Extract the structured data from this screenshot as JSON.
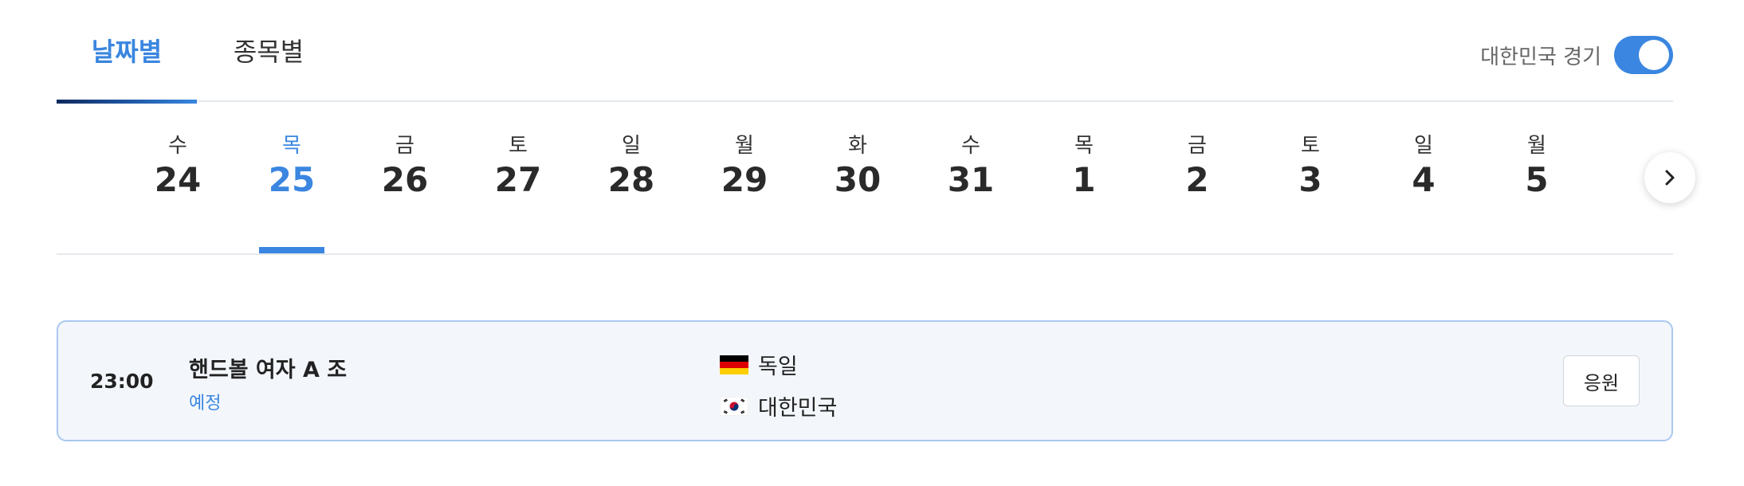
{
  "tabs": {
    "by_date": "날짜별",
    "by_sport": "종목별"
  },
  "korea_toggle": {
    "label": "대한민국 경기",
    "on": true
  },
  "dates": [
    {
      "weekday": "수",
      "day": "24"
    },
    {
      "weekday": "목",
      "day": "25",
      "active": true
    },
    {
      "weekday": "금",
      "day": "26"
    },
    {
      "weekday": "토",
      "day": "27"
    },
    {
      "weekday": "일",
      "day": "28"
    },
    {
      "weekday": "월",
      "day": "29"
    },
    {
      "weekday": "화",
      "day": "30"
    },
    {
      "weekday": "수",
      "day": "31"
    },
    {
      "weekday": "목",
      "day": "1"
    },
    {
      "weekday": "금",
      "day": "2"
    },
    {
      "weekday": "토",
      "day": "3"
    },
    {
      "weekday": "일",
      "day": "4"
    },
    {
      "weekday": "월",
      "day": "5"
    }
  ],
  "next_icon": "chevron-right-icon",
  "game": {
    "time": "23:00",
    "title": "핸드볼 여자 A 조",
    "status": "예정",
    "teams": [
      {
        "name": "독일",
        "flag": "germany-flag-icon"
      },
      {
        "name": "대한민국",
        "flag": "korea-flag-icon"
      }
    ],
    "cheer_label": "응원"
  },
  "colors": {
    "accent": "#3a86e0",
    "card_bg": "#f3f7fc",
    "card_border": "#a9c8f0"
  }
}
